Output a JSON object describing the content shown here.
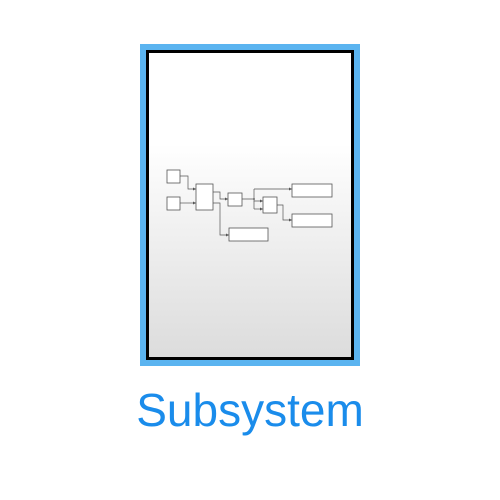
{
  "block": {
    "label": "Subsystem",
    "icon": "subsystem-diagram-icon",
    "frame_color": "#5bb4f0",
    "label_color": "#1a8ceb"
  }
}
